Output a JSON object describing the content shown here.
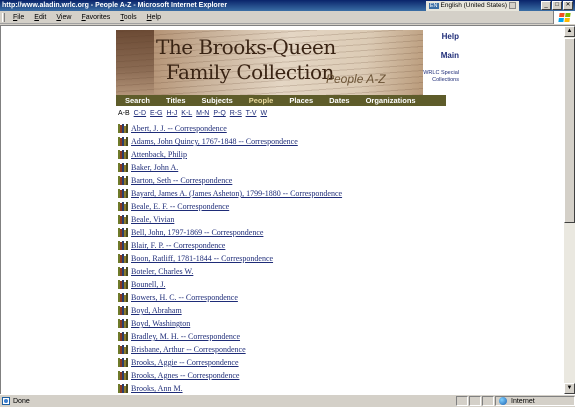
{
  "window": {
    "title": "http://www.aladin.wrlc.org - People A-Z - Microsoft Internet Explorer",
    "language_code": "EN",
    "language": "English (United States)",
    "buttons": {
      "minimize": "_",
      "maximize": "□",
      "close": "✕"
    }
  },
  "menu": [
    "File",
    "Edit",
    "View",
    "Favorites",
    "Tools",
    "Help"
  ],
  "banner": {
    "title_line1": "The Brooks-Queen",
    "title_line2": "Family Collection",
    "section": "People A-Z"
  },
  "side_links": {
    "help": "Help",
    "main": "Main",
    "wrlc": "WRLC Special Collections"
  },
  "nav": [
    "Search",
    "Titles",
    "Subjects",
    "People",
    "Places",
    "Dates",
    "Organizations"
  ],
  "nav_active": "People",
  "alpha_index": {
    "current": "A-B",
    "links": [
      "C-D",
      "E-G",
      "H-J",
      "K-L",
      "M-N",
      "P-Q",
      "R-S",
      "T-V",
      "W"
    ]
  },
  "people": [
    "Abert, J. J. -- Correspondence",
    "Adams, John Quincy, 1767-1848 -- Correspondence",
    "Attenback, Philip",
    "Baker, John A.",
    "Barton, Seth -- Correspondence",
    "Bayard, James A. (James Asheton), 1799-1880 -- Correspondence",
    "Beale, E. F. -- Correspondence",
    "Beale, Vivian",
    "Bell, John, 1797-1869 -- Correspondence",
    "Blair, F. P. -- Correspondence",
    "Boon, Ratliff, 1781-1844 -- Correspondence",
    "Boteler, Charles W.",
    "Bounell, J.",
    "Bowers, H. C. -- Correspondence",
    "Boyd, Abraham",
    "Boyd, Washington",
    "Bradley, M. H. -- Correspondence",
    "Brisbane, Arthur -- Correspondence",
    "Brooks, Aggie -- Correspondence",
    "Brooks, Agnes -- Correspondence",
    "Brooks, Ann M."
  ],
  "status": {
    "left": "Done",
    "zone": "Internet"
  },
  "scrollbar": {
    "up": "▲",
    "down": "▼"
  }
}
